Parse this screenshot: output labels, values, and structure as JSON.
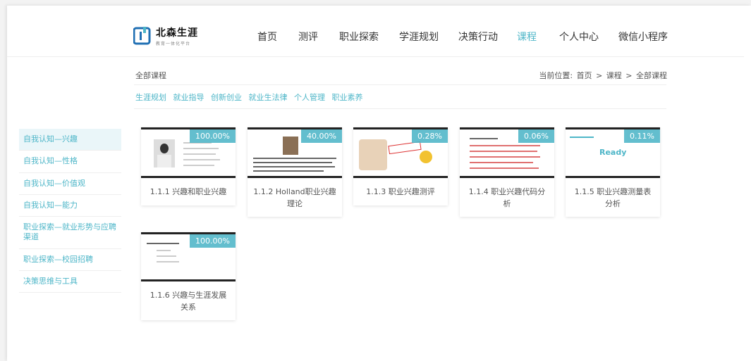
{
  "brand": {
    "name": "北森生涯",
    "tagline": "教育一体化平台",
    "primary": "#4eb6c8"
  },
  "nav": [
    {
      "label": "首页",
      "active": false
    },
    {
      "label": "测评",
      "active": false
    },
    {
      "label": "职业探索",
      "active": false
    },
    {
      "label": "学涯规划",
      "active": false
    },
    {
      "label": "决策行动",
      "active": false
    },
    {
      "label": "课程",
      "active": true
    },
    {
      "label": "个人中心",
      "active": false
    },
    {
      "label": "微信小程序",
      "active": false
    }
  ],
  "breadcrumb": {
    "current_section": "全部课程",
    "location_label": "当前位置:",
    "path": [
      "首页",
      ">",
      "课程",
      ">",
      "全部课程"
    ]
  },
  "categories": [
    "生涯规划",
    "就业指导",
    "创新创业",
    "就业生法律",
    "个人管理",
    "职业素养"
  ],
  "sidebar": [
    {
      "label": "自我认知—兴趣",
      "active": true
    },
    {
      "label": "自我认知—性格",
      "active": false
    },
    {
      "label": "自我认知—价值观",
      "active": false
    },
    {
      "label": "自我认知—能力",
      "active": false
    },
    {
      "label": "职业探索—就业形势与应聘渠道",
      "active": false
    },
    {
      "label": "职业探索—校园招聘",
      "active": false
    },
    {
      "label": "决策思维与工具",
      "active": false
    }
  ],
  "courses": [
    {
      "title": "1.1.1 兴趣和职业兴趣",
      "progress": "100.00%"
    },
    {
      "title": "1.1.2 Holland职业兴趣理论",
      "progress": "40.00%"
    },
    {
      "title": "1.1.3 职业兴趣测评",
      "progress": "0.28%"
    },
    {
      "title": "1.1.4 职业兴趣代码分析",
      "progress": "0.06%"
    },
    {
      "title": "1.1.5 职业兴趣测量表分析",
      "progress": "0.11%",
      "thumb_text": "Ready"
    },
    {
      "title": "1.1.6 兴趣与生涯发展关系",
      "progress": "100.00%"
    }
  ]
}
